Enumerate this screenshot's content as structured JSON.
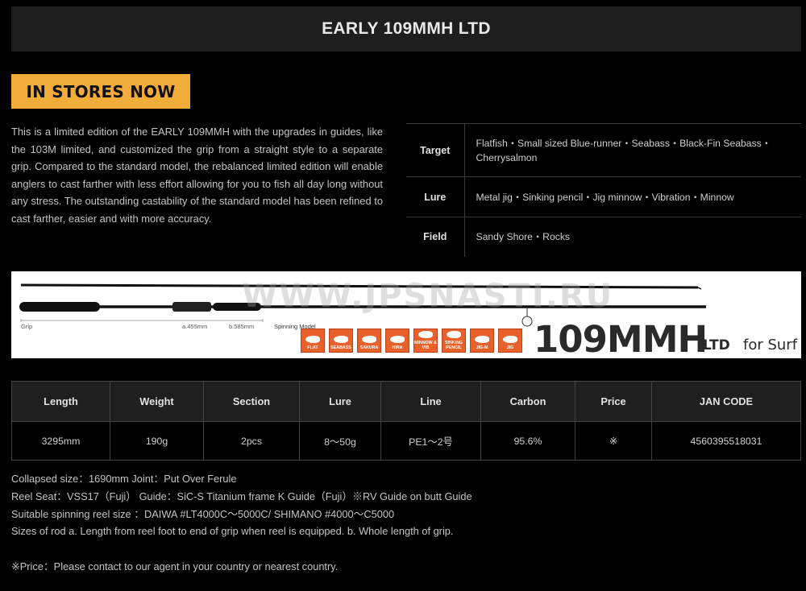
{
  "title": "EARLY 109MMH LTD",
  "badge": "IN STORES NOW",
  "description": "This is a limited edition of the EARLY 109MMH with the upgrades in guides, like the 103M limited, and customized the grip from a straight style to a separate grip. Compared to the standard model, the rebalanced limited edition will enable anglers to cast farther with less effort allowing for you to fish all day long without any stress. The outstanding castability of the standard model has been refined to cast farther, easier and with more accuracy.",
  "target_table": {
    "target_label": "Target",
    "target_value": "Flatfish・Small sized Blue-runner・Seabass・Black-Fin Seabass・Cherrysalmon",
    "lure_label": "Lure",
    "lure_value": "Metal jig・Sinking pencil・Jig minnow・Vibration・Minnow",
    "field_label": "Field",
    "field_value": "Sandy Shore・Rocks"
  },
  "banner": {
    "watermark": "WWW.JPSNASTI.RU",
    "grip_label": "Grip",
    "a_label": "a.455mm",
    "b_label": "b.585mm",
    "spinning_label": "Spinning Model",
    "model_number": "109MMH",
    "model_ltd": "LTD",
    "model_surf": "for Surf",
    "accent_color": "#e8612a",
    "lure_icons": [
      {
        "icon": "flatfish-icon",
        "label": "FLAT"
      },
      {
        "icon": "seabass-icon",
        "label": "SEABASS"
      },
      {
        "icon": "sakura-icon",
        "label": "SAKURA"
      },
      {
        "icon": "hira-icon",
        "label": "HIRA"
      },
      {
        "icon": "minnow-icon",
        "label": "MINNOW & VIB"
      },
      {
        "icon": "sinking-pencil-icon",
        "label": "SINKING PENCIL"
      },
      {
        "icon": "jig-minnow-icon",
        "label": "JIG-M"
      },
      {
        "icon": "jig-icon",
        "label": "JIG"
      }
    ]
  },
  "spec_table": {
    "headers": [
      "Length",
      "Weight",
      "Section",
      "Lure",
      "Line",
      "Carbon",
      "Price",
      "JAN CODE"
    ],
    "row": [
      "3295mm",
      "190g",
      "2pcs",
      "8～50g",
      "PE1～2号",
      "95.6%",
      "※",
      "4560395518031"
    ]
  },
  "notes": {
    "line1": "Collapsed size：1690mm Joint：Put Over Ferule",
    "line2": "Reel Seat：VSS17（Fuji） Guide：SiC-S Titanium frame K Guide（Fuji）※RV Guide on butt Guide",
    "line3": "Suitable spinning reel size ：DAIWA #LT4000C～5000C/ SHIMANO #4000～C5000",
    "line4": "Sizes of rod a. Length from reel foot to end of grip when reel is equipped. b. Whole length of grip.",
    "line5": "※Price：Please contact to our agent in your country or nearest country."
  }
}
